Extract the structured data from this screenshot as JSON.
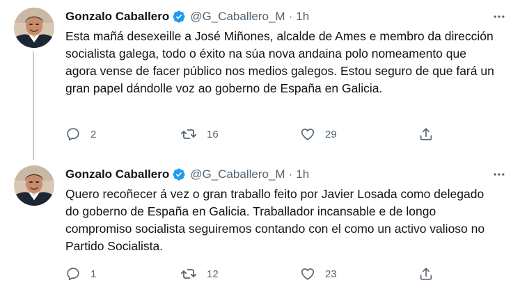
{
  "tweets": [
    {
      "name": "Gonzalo Caballero",
      "handle": "@G_Caballero_M",
      "dot": "·",
      "time": "1h",
      "text": "Esta mañá desexeille a José Miñones, alcalde de Ames e membro da dirección socialista galega, todo o éxito na súa nova andaina polo nomeamento que agora vense de facer público nos medios galegos. Estou seguro de que fará un gran papel dándolle voz ao goberno de España en Galicia.",
      "replies": "2",
      "retweets": "16",
      "likes": "29"
    },
    {
      "name": "Gonzalo Caballero",
      "handle": "@G_Caballero_M",
      "dot": "·",
      "time": "1h",
      "text": "Quero recoñecer á vez o gran traballo feito por Javier Losada como delegado do goberno de España en Galicia. Traballador incansable e de longo compromiso socialista seguiremos contando con el como un activo valioso no Partido Socialista.",
      "replies": "1",
      "retweets": "12",
      "likes": "23"
    }
  ],
  "colors": {
    "text": "#0f1419",
    "secondary": "#536471",
    "verified": "#1d9bf0",
    "thread_line": "#c4cfd6"
  },
  "icons": [
    "avatar-photo",
    "verified-badge-icon",
    "more-icon",
    "reply-icon",
    "retweet-icon",
    "like-icon",
    "share-icon"
  ]
}
